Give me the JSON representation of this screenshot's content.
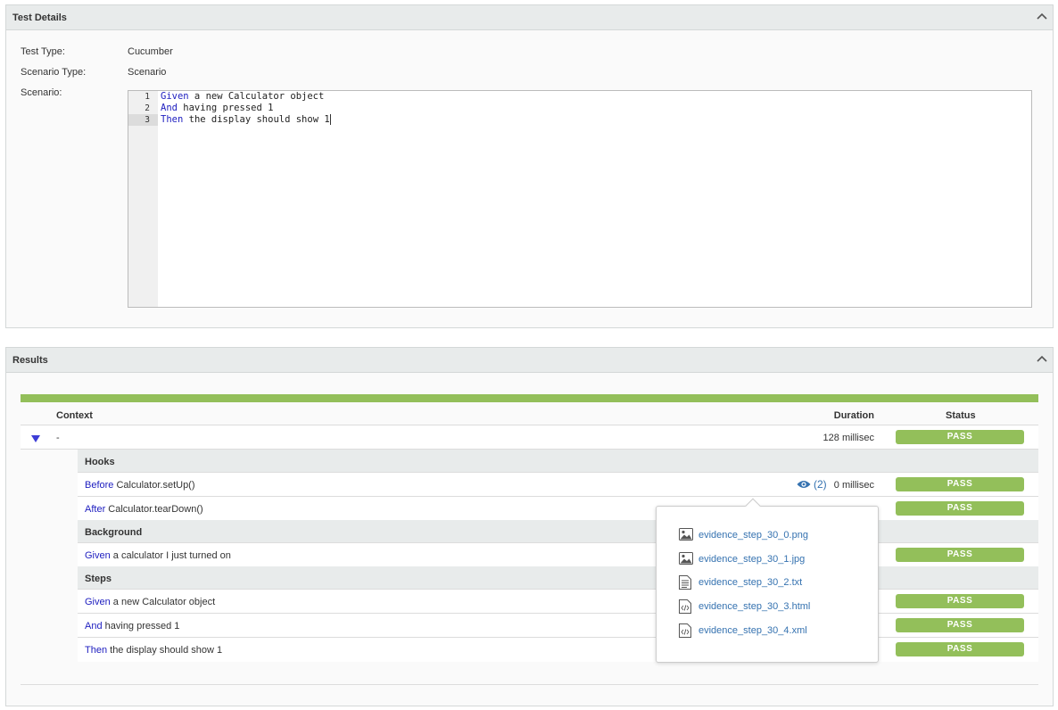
{
  "details": {
    "title": "Test Details",
    "rows": [
      {
        "label": "Test Type:",
        "value": "Cucumber"
      },
      {
        "label": "Scenario Type:",
        "value": "Scenario"
      },
      {
        "label": "Scenario:"
      }
    ],
    "editor": {
      "lines": [
        {
          "num": "1",
          "keyword": "Given",
          "text": " a new Calculator object"
        },
        {
          "num": "2",
          "keyword": "And",
          "text": " having pressed 1"
        },
        {
          "num": "3",
          "keyword": "Then",
          "text": " the display should show 1"
        }
      ],
      "active_line": "3"
    }
  },
  "results": {
    "title": "Results",
    "progress_pass_fraction": 1.0,
    "progress_color": "#93bf5a",
    "columns": {
      "context": "Context",
      "duration": "Duration",
      "status": "Status"
    },
    "context_row": {
      "label": "-",
      "duration": "128 millisec",
      "status": "PASS"
    },
    "groups": [
      {
        "title": "Hooks",
        "steps": [
          {
            "keyword": "Before",
            "text": " Calculator.setUp()",
            "duration": "0 millisec",
            "status": "PASS",
            "evidence_count": "(2)"
          },
          {
            "keyword": "After",
            "text": " Calculator.tearDown()",
            "status": "PASS"
          }
        ]
      },
      {
        "title": "Background",
        "steps": [
          {
            "keyword": "Given",
            "text": " a calculator I just turned on",
            "status": "PASS"
          }
        ]
      },
      {
        "title": "Steps",
        "steps": [
          {
            "keyword": "Given",
            "text": " a new Calculator object",
            "status": "PASS"
          },
          {
            "keyword": "And",
            "text": " having pressed 1",
            "status": "PASS"
          },
          {
            "keyword": "Then",
            "text": " the display should show 1",
            "status": "PASS"
          }
        ]
      }
    ],
    "evidence_popover": [
      {
        "name": "evidence_step_30_0.png",
        "icon": "image-icon"
      },
      {
        "name": "evidence_step_30_1.jpg",
        "icon": "image-icon"
      },
      {
        "name": "evidence_step_30_2.txt",
        "icon": "text-file-icon"
      },
      {
        "name": "evidence_step_30_3.html",
        "icon": "code-file-icon"
      },
      {
        "name": "evidence_step_30_4.xml",
        "icon": "code-file-icon"
      }
    ]
  },
  "colors": {
    "pass": "#93bf5a",
    "keyword": "#2020c0",
    "link": "#3572b0",
    "header_bg": "#e8ebeb"
  }
}
